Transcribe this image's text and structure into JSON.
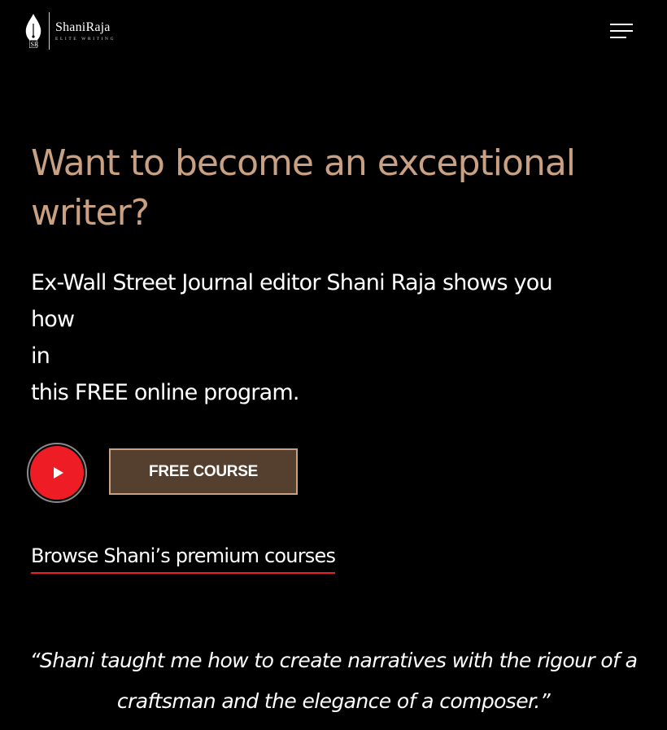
{
  "header": {
    "logo_name": "ShaniRaja",
    "logo_tagline": "ELITE WRITING",
    "logo_monogram": "SR",
    "menu_icon": "hamburger-menu-icon"
  },
  "hero": {
    "title_line1": "Want to become an exceptional",
    "title_line2": "writer?",
    "subtitle_line1": "Ex-Wall Street Journal editor Shani Raja shows you how",
    "subtitle_line2": "in",
    "subtitle_line3": "this FREE online program."
  },
  "actions": {
    "play_icon": "play-icon",
    "free_course_label": "FREE COURSE",
    "browse_link_label": "Browse Shani’s premium courses"
  },
  "testimonial": {
    "line1": "“Shani taught me how to create narratives with the rigour of a",
    "line2": "craftsman and the elegance of a composer.”"
  },
  "colors": {
    "background": "#000000",
    "accent_gold": "#c9a082",
    "button_brown": "#55402f",
    "play_red": "#ee1c25",
    "link_underline": "#ee1c25"
  }
}
